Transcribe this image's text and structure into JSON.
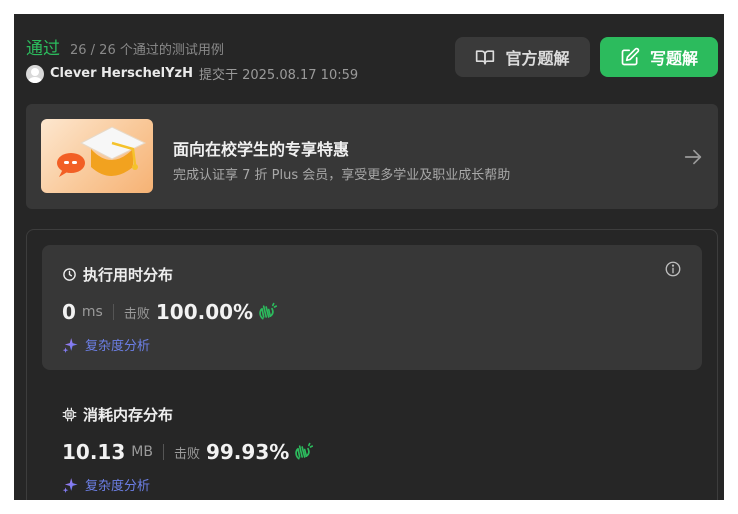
{
  "header": {
    "status": "通过",
    "summary": "26 / 26 个通过的测试用例",
    "author": "Clever HerschelYzH",
    "submitted": "提交于 2025.08.17 10:59"
  },
  "buttons": {
    "official": "官方题解",
    "write": "写题解"
  },
  "promo": {
    "title": "面向在校学生的专享特惠",
    "desc": "完成认证享 7 折 Plus 会员，享受更多学业及职业成长帮助"
  },
  "runtime": {
    "title": "执行用时分布",
    "value": "0",
    "unit": "ms",
    "beat_label": "击败",
    "beat_value": "100.00%",
    "analysis": "复杂度分析"
  },
  "memory": {
    "title": "消耗内存分布",
    "value": "10.13",
    "unit": "MB",
    "beat_label": "击败",
    "beat_value": "99.93%",
    "analysis": "复杂度分析"
  },
  "colors": {
    "accept": "#2cbb5d",
    "panel": "#262626",
    "card": "#373737",
    "analysis": "#6c7fe6"
  },
  "icons": [
    "book-icon",
    "edit-icon",
    "arrow-right-icon",
    "clock-icon",
    "info-icon",
    "chip-icon",
    "clap-icon",
    "sparkle-icon",
    "avatar"
  ]
}
